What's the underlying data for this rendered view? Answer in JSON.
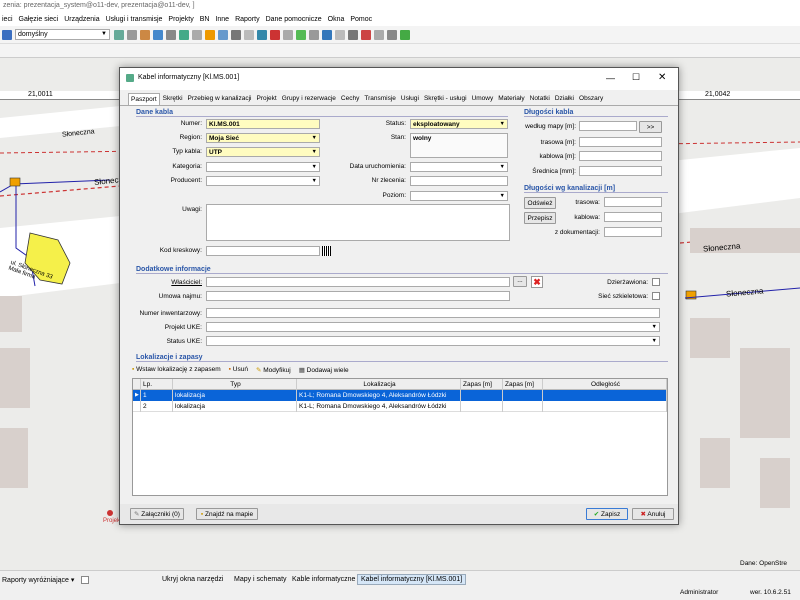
{
  "app": {
    "title": "zenia: prezentacja_system@o11-dev, prezentacja@o11-dev, ]",
    "menu": [
      "ieci",
      "Gałęzie sieci",
      "Urządzenia",
      "Usługi i transmisje",
      "Projekty",
      "BN",
      "Inne",
      "Raporty",
      "Dane pomocnicze",
      "Okna",
      "Pomoc"
    ],
    "toolbar": {
      "profile_value": "domyślny"
    }
  },
  "map": {
    "ruler": [
      "21,0011",
      "21,0042"
    ],
    "streets": [
      "Słoneczna",
      "Słoneczna",
      "Słoneczna",
      "Słoneczna"
    ],
    "building_label": "ul. Słoneczna 33 Mała firma",
    "project_label": "Projekt",
    "attribution": "Dane: OpenStre"
  },
  "dialog": {
    "title": "Kabel informatyczny [Kl.MS.001]",
    "tabs": [
      "Paszport",
      "Skrętki",
      "Przebieg w kanalizacji",
      "Projekt",
      "Grupy i rezerwacje",
      "Cechy",
      "Transmisje",
      "Usługi",
      "Skrętki - usługi",
      "Umowy",
      "Materiały",
      "Notatki",
      "Działki",
      "Obszary"
    ],
    "dane": {
      "section": "Dane kabla",
      "numer_label": "Numer:",
      "numer": "Kl.MS.001",
      "region_label": "Region:",
      "region": "Moja Sieć",
      "typ_label": "Typ kabla:",
      "typ": "UTP",
      "kategoria_label": "Kategoria:",
      "producent_label": "Producent:",
      "uwagi_label": "Uwagi:",
      "kod_label": "Kod kreskowy:",
      "status_label": "Status:",
      "status": "eksploatowany",
      "stan_label": "Stan:",
      "stan": "wolny",
      "data_label": "Data uruchomienia:",
      "nr_label": "Nr zlecenia:",
      "poziom_label": "Poziom:"
    },
    "dlugosci": {
      "section": "Długości kabla",
      "wedlug_label": "według mapy [m]:",
      "trasowa_label": "trasowa [m]:",
      "kablowa_label": "kablowa [m]:",
      "srednica_label": "Średnica [mm]:",
      "arrow_btn": ">>"
    },
    "kanal": {
      "section": "Długości wg kanalizacji [m]",
      "odswiez": "Odśwież",
      "przepisz": "Przepisz",
      "trasowa": "trasowa:",
      "kablowa": "kablowa:",
      "zdok": "z dokumentacji:"
    },
    "dodatkowe": {
      "section": "Dodatkowe informacje",
      "wlasciciel": "Właściciel:",
      "umowa": "Umowa najmu:",
      "numer_inw": "Numer inwentarzowy:",
      "projekt_uke": "Projekt UKE:",
      "status_uke": "Status UKE:",
      "dzierzawiona": "Dzierżawiona:",
      "siec_szkieletowa": "Sieć szkieletowa:",
      "ellipsis": "..."
    },
    "lokalizacje": {
      "section": "Lokalizacje i zapasy",
      "btn_wstaw": "Wstaw lokalizację z zapasem",
      "btn_usun": "Usuń",
      "btn_modyfikuj": "Modyfikuj",
      "btn_dodawaj": "Dodawaj wiele",
      "columns": [
        "Lp.",
        "Typ",
        "Lokalizacja",
        "Zapas [m]",
        "Zapas [m]",
        "Odległość"
      ],
      "rows": [
        {
          "lp": "1",
          "typ": "lokalizacja",
          "lok": "K1-L; Romana Dmowskiego 4, Aleksandrów Łódzki"
        },
        {
          "lp": "2",
          "typ": "lokalizacja",
          "lok": "K1-L; Romana Dmowskiego 4, Aleksandrów Łódzki"
        }
      ]
    },
    "footer": {
      "zalaczniki": "Załączniki (0)",
      "znajdz": "Znajdź na mapie",
      "zapisz": "Zapisz",
      "anuluj": "Anuluj"
    }
  },
  "bottom": {
    "raporty": "Raporty wyróżniające",
    "tabs": [
      "Ukryj okna narzędzi",
      "Mapy i schematy",
      "Kable informatyczne",
      "Kabel informatyczny [Kl.MS.001]"
    ],
    "user": "Administrator",
    "version": "wer. 10.6.2.51"
  }
}
